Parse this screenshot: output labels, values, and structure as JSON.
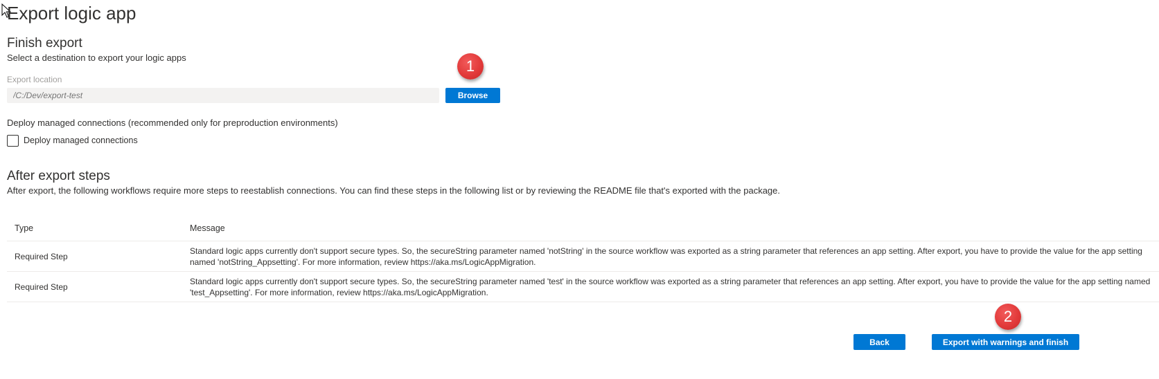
{
  "page": {
    "title": "Export logic app"
  },
  "finish_export": {
    "heading": "Finish export",
    "description": "Select a destination to export your logic apps",
    "location_label": "Export location",
    "location_placeholder": "/C:/Dev/export-test",
    "browse_label": "Browse",
    "callout_1": "1"
  },
  "managed_connections": {
    "description": "Deploy managed connections (recommended only for preproduction environments)",
    "checkbox_label": "Deploy managed connections",
    "checked": false
  },
  "after_export": {
    "heading": "After export steps",
    "description": "After export, the following workflows require more steps to reestablish connections. You can find these steps in the following list or by reviewing the README file that's exported with the package.",
    "columns": [
      "Type",
      "Message"
    ],
    "rows": [
      {
        "type": "Required Step",
        "message": "Standard logic apps currently don't support secure types. So, the secureString parameter named 'notString' in the source workflow was exported as a string parameter that references an app setting. After export, you have to provide the value for the app setting named 'notString_Appsetting'. For more information, review https://aka.ms/LogicAppMigration."
      },
      {
        "type": "Required Step",
        "message": "Standard logic apps currently don't support secure types. So, the secureString parameter named 'test' in the source workflow was exported as a string parameter that references an app setting. After export, you have to provide the value for the app setting named 'test_Appsetting'. For more information, review https://aka.ms/LogicAppMigration."
      }
    ]
  },
  "footer": {
    "back_label": "Back",
    "finish_label": "Export with warnings and finish",
    "callout_2": "2"
  },
  "colors": {
    "accent": "#0078d4",
    "callout": "#e23a3a",
    "text": "#323130",
    "muted": "#a19f9d"
  },
  "icons": {
    "cursor": "mouse-pointer-icon"
  }
}
